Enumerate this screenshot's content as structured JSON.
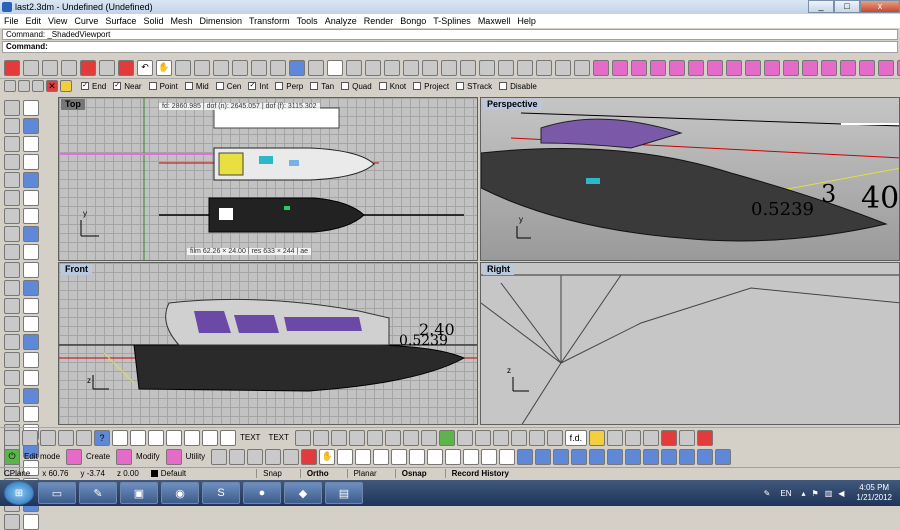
{
  "window": {
    "title": "last2.3dm - Undefined (Undefined)",
    "min_glyph": "_",
    "max_glyph": "□",
    "close_glyph": "x"
  },
  "menu": [
    "File",
    "Edit",
    "View",
    "Curve",
    "Surface",
    "Solid",
    "Mesh",
    "Dimension",
    "Transform",
    "Tools",
    "Analyze",
    "Render",
    "Bongo",
    "T-Splines",
    "Maxwell",
    "Help"
  ],
  "command": {
    "history": "Command: _ShadedViewport",
    "prompt": "Command:",
    "value": ""
  },
  "osnap": [
    {
      "label": "End",
      "checked": true
    },
    {
      "label": "Near",
      "checked": true
    },
    {
      "label": "Point",
      "checked": false
    },
    {
      "label": "Mid",
      "checked": false
    },
    {
      "label": "Cen",
      "checked": false
    },
    {
      "label": "Int",
      "checked": true
    },
    {
      "label": "Perp",
      "checked": false
    },
    {
      "label": "Tan",
      "checked": false
    },
    {
      "label": "Quad",
      "checked": false
    },
    {
      "label": "Knot",
      "checked": false
    },
    {
      "label": "Project",
      "checked": false
    },
    {
      "label": "STrack",
      "checked": false
    },
    {
      "label": "Disable",
      "checked": false
    }
  ],
  "viewports": {
    "top": {
      "title": "Top",
      "overlay_top": "fd: 2860.985 | dof (n): 2645.057 | dof (f): 3115.302",
      "overlay_bottom": "film 62.26 × 24.00 | res 633 × 244 | ae"
    },
    "perspective": {
      "title": "Perspective",
      "dim_big": "40",
      "dim_mid": "0.5239",
      "dim_small": "3"
    },
    "front": {
      "title": "Front",
      "dim_top": "2.40",
      "dim_bottom": "0.5239"
    },
    "right": {
      "title": "Right"
    }
  },
  "toolbar_bottom": {
    "edit_mode": "Edit mode",
    "create": "Create",
    "modify": "Modify",
    "utility": "Utility",
    "text1": "TEXT",
    "text2": "TEXT",
    "fd": "f.d."
  },
  "status": {
    "cplane": "CPlane",
    "x": "x 60.76",
    "y": "y -3.74",
    "z": "z 0.00",
    "layer": "Default",
    "panes": [
      "Snap",
      "Ortho",
      "Planar",
      "Osnap",
      "Record History"
    ]
  },
  "taskbar": {
    "lang": "EN",
    "time": "4:05 PM",
    "date": "1/21/2012"
  }
}
